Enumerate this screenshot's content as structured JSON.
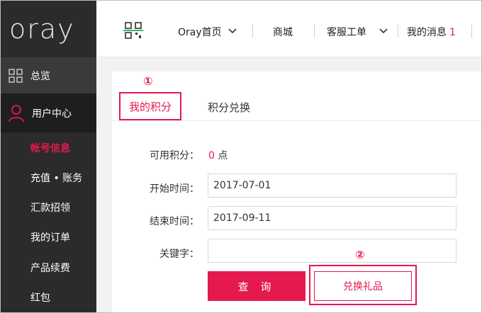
{
  "brand": {
    "logo_text": "oray",
    "accent_color": "#e5194e"
  },
  "sidebar": {
    "overview_label": "总览",
    "user_center_label": "用户中心",
    "sub_items": [
      {
        "label": "帐号信息",
        "active": true
      },
      {
        "label": "充值 • 账务",
        "active": false
      },
      {
        "label": "汇款招领",
        "active": false
      },
      {
        "label": "我的订单",
        "active": false
      },
      {
        "label": "产品续费",
        "active": false
      },
      {
        "label": "红包",
        "active": false
      }
    ]
  },
  "header": {
    "home_label": "Oray首页",
    "shop_label": "商城",
    "service_label": "客服工单",
    "messages_label": "我的消息",
    "messages_count": "1"
  },
  "tabs": {
    "active_label": "我的积分",
    "inactive_label": "积分兑换",
    "marker_1": "①",
    "marker_2": "②"
  },
  "form": {
    "points_label": "可用积分：",
    "points_value": "0",
    "points_unit": "点",
    "start_label": "开始时间：",
    "start_value": "2017-07-01",
    "end_label": "结束时间：",
    "end_value": "2017-09-11",
    "keyword_label": "关键字：",
    "keyword_value": ""
  },
  "buttons": {
    "query_label": "查 询",
    "exchange_label": "兑换礼品"
  }
}
